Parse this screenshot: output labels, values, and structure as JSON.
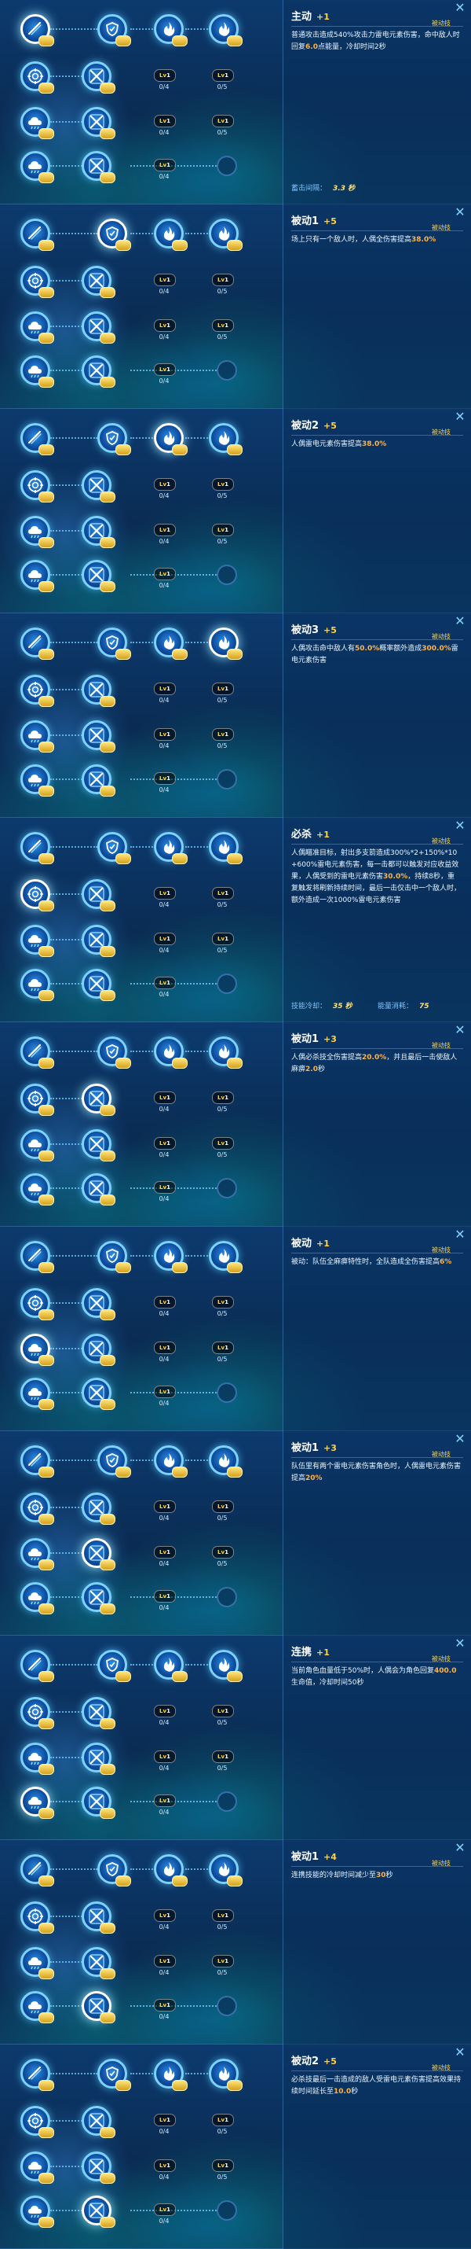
{
  "colors": {
    "active_ring": "#7dd3ff",
    "highlight": "#ffb347",
    "level_plus": "#ffd24a",
    "stat_label": "#7fc4ff"
  },
  "icons": {
    "row1": [
      "electro-slash-icon",
      "hand-shield-icon",
      "electro-flame-icon",
      "electro-flame-icon"
    ],
    "row2": [
      "target-icon",
      "crossed-swords-icon"
    ],
    "row3": [
      "ice-cloud-icon",
      "crossed-swords-icon"
    ],
    "row4": [
      "ice-cloud-icon",
      "crossed-swords-icon"
    ]
  },
  "grid": {
    "question_mark": "?",
    "counts": {
      "a": "0/4",
      "b": "0/5"
    },
    "level_prefix": "Lv",
    "level_value": "1"
  },
  "panels": [
    {
      "selected": "row1-col1",
      "title": "主动",
      "plus": "+1",
      "tag": "被动技",
      "desc": [
        {
          "t": "普通攻击造成540%攻击力雷电元素伤害，命中敌人时回复"
        },
        {
          "t": "6.0",
          "h": true
        },
        {
          "t": "点能量，冷却时间2秒"
        }
      ],
      "stats": [
        {
          "label": "蓄击间隔：",
          "value": "3.3",
          "unit": "秒"
        }
      ]
    },
    {
      "selected": "row1-col2",
      "title": "被动1",
      "plus": "+5",
      "tag": "被动技",
      "desc": [
        {
          "t": "场上只有一个敌人时，人偶全伤害提高"
        },
        {
          "t": "38.0%",
          "h": true
        }
      ],
      "stats": []
    },
    {
      "selected": "row1-col3",
      "title": "被动2",
      "plus": "+5",
      "tag": "被动技",
      "desc": [
        {
          "t": "人偶雷电元素伤害提高"
        },
        {
          "t": "38.0%",
          "h": true
        }
      ],
      "stats": []
    },
    {
      "selected": "row1-col4",
      "title": "被动3",
      "plus": "+5",
      "tag": "被动技",
      "desc": [
        {
          "t": "人偶攻击命中敌人有"
        },
        {
          "t": "50.0%",
          "h": true
        },
        {
          "t": "概率额外造成"
        },
        {
          "t": "300.0%",
          "h": true
        },
        {
          "t": "雷电元素伤害"
        }
      ],
      "stats": []
    },
    {
      "selected": "row2-col1",
      "title": "必杀",
      "plus": "+1",
      "tag": "被动技",
      "desc": [
        {
          "t": "人偶瞄准目标，射出多支箭造成300%*2+150%*10+600%雷电元素伤害，每一击都可以触发对应收益效果，人偶受到的雷电元素伤害"
        },
        {
          "t": "30.0%",
          "h": true
        },
        {
          "t": "，持续8秒，重复触发将刷新持续时间，最后一击仅击中一个敌人时，额外造成一次1000%雷电元素伤害"
        }
      ],
      "stats": [
        {
          "label": "技能冷却：",
          "value": "35",
          "unit": "秒"
        },
        {
          "label": "能量消耗：",
          "value": "75",
          "unit": ""
        }
      ]
    },
    {
      "selected": "row2-col2",
      "title": "被动1",
      "plus": "+3",
      "tag": "被动技",
      "desc": [
        {
          "t": "人偶必杀技全伤害提高"
        },
        {
          "t": "20.0%",
          "h": true
        },
        {
          "t": "，并且最后一击使敌人麻痹"
        },
        {
          "t": "2.0",
          "h": true
        },
        {
          "t": "秒"
        }
      ],
      "stats": []
    },
    {
      "selected": "row3-col1",
      "title": "被动",
      "plus": "+1",
      "tag": "被动技",
      "desc": [
        {
          "t": "被动：队伍全麻痹特性时，全队造成全伤害提高"
        },
        {
          "t": "6%",
          "h": true
        }
      ],
      "stats": []
    },
    {
      "selected": "row3-col2",
      "title": "被动1",
      "plus": "+3",
      "tag": "被动技",
      "desc": [
        {
          "t": "队伍里有两个雷电元素伤害角色时，人偶雷电元素伤害提高"
        },
        {
          "t": "20%",
          "h": true
        }
      ],
      "stats": []
    },
    {
      "selected": "row4-col1",
      "title": "连携",
      "plus": "+1",
      "tag": "被动技",
      "desc": [
        {
          "t": "当前角色血量低于50%时，人偶会为角色回复"
        },
        {
          "t": "400.0",
          "h": true
        },
        {
          "t": "生命值，冷却时间50秒"
        }
      ],
      "stats": []
    },
    {
      "selected": "row4-col2",
      "title": "被动1",
      "plus": "+4",
      "tag": "被动技",
      "desc": [
        {
          "t": "连携技能的冷却时间减少至"
        },
        {
          "t": "30",
          "h": true
        },
        {
          "t": "秒"
        }
      ],
      "stats": []
    },
    {
      "selected": "row4-col2",
      "title": "被动2",
      "plus": "+5",
      "tag": "被动技",
      "desc": [
        {
          "t": "必杀技最后一击造成的敌人受雷电元素伤害提高效果持续时间延长至"
        },
        {
          "t": "10.0",
          "h": true
        },
        {
          "t": "秒"
        }
      ],
      "stats": []
    }
  ]
}
